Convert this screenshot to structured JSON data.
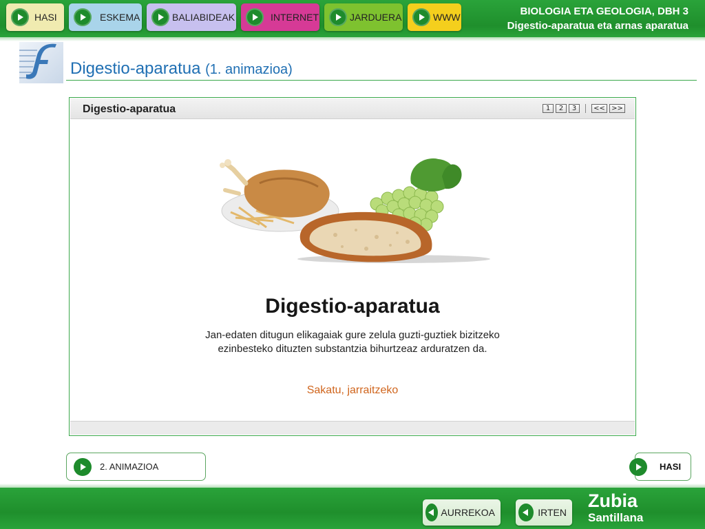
{
  "nav": {
    "items": [
      {
        "label": "HASI",
        "color": "#f0ebb0"
      },
      {
        "label": "ESKEMA",
        "color": "#a9d4ea"
      },
      {
        "label": "BALIABIDEAK",
        "color": "#c7c0ef"
      },
      {
        "label": "INTERNET",
        "color": "#d63a96"
      },
      {
        "label": "JARDUERA",
        "color": "#7ec22f"
      },
      {
        "label": "WWW",
        "color": "#f4cf1d"
      }
    ]
  },
  "header": {
    "line1": "BIOLOGIA ETA GEOLOGIA, DBH 3",
    "line2": "Digestio-aparatua eta arnas aparatua"
  },
  "page": {
    "title": "Digestio-aparatua",
    "subtitle": "(1. animazioa)"
  },
  "animation": {
    "header_title": "Digestio-aparatua",
    "pages": [
      "1",
      "2",
      "3"
    ],
    "prev": "<<",
    "next": ">>",
    "main_title": "Digestio-aparatua",
    "description_line1": "Jan-edaten ditugun elikagaiak gure zelula guzti-guztiek bizitzeko",
    "description_line2": "ezinbesteko dituzten substantzia bihurtzeaz arduratzen da.",
    "continue": "Sakatu, jarraitzeko"
  },
  "buttons": {
    "next_animation": "2. ANIMAZIOA",
    "home": "HASI"
  },
  "footer": {
    "back": "AURREKOA",
    "exit": "IRTEN",
    "brand1": "Zubia",
    "brand2": "Santillana"
  },
  "colors": {
    "bar_green": "#1f8f2c",
    "title_blue": "#1f6fb3",
    "continue_orange": "#d0651d"
  }
}
